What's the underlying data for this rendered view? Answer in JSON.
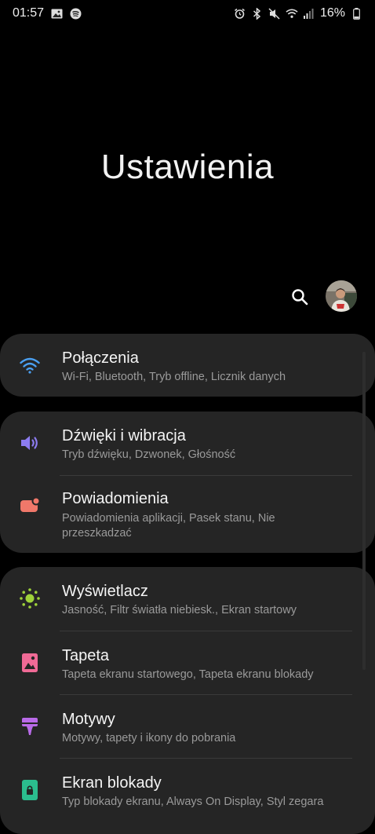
{
  "status": {
    "time": "01:57",
    "battery": "16%"
  },
  "header": {
    "title": "Ustawienia"
  },
  "groups": [
    {
      "items": [
        {
          "title": "Połączenia",
          "subtitle": "Wi-Fi, Bluetooth, Tryb offline, Licznik danych",
          "icon": "wifi-icon",
          "color": "#4a9ff0"
        }
      ]
    },
    {
      "items": [
        {
          "title": "Dźwięki i wibracja",
          "subtitle": "Tryb dźwięku, Dzwonek, Głośność",
          "icon": "volume-icon",
          "color": "#8c7cf0"
        },
        {
          "title": "Powiadomienia",
          "subtitle": "Powiadomienia aplikacji, Pasek stanu, Nie przeszkadzać",
          "icon": "notification-icon",
          "color": "#f0786a"
        }
      ]
    },
    {
      "items": [
        {
          "title": "Wyświetlacz",
          "subtitle": "Jasność, Filtr światła niebiesk., Ekran startowy",
          "icon": "brightness-icon",
          "color": "#9ed23a"
        },
        {
          "title": "Tapeta",
          "subtitle": "Tapeta ekranu startowego, Tapeta ekranu blokady",
          "icon": "wallpaper-icon",
          "color": "#f06a96"
        },
        {
          "title": "Motywy",
          "subtitle": "Motywy, tapety i ikony do pobrania",
          "icon": "themes-icon",
          "color": "#b96ae8"
        },
        {
          "title": "Ekran blokady",
          "subtitle": "Typ blokady ekranu, Always On Display, Styl zegara",
          "icon": "lock-screen-icon",
          "color": "#2bbd8e"
        }
      ]
    }
  ]
}
